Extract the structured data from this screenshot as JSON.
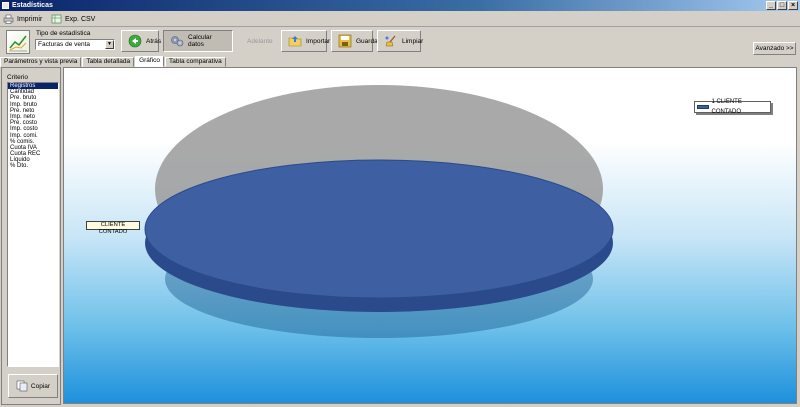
{
  "window": {
    "title": "Estadísticas",
    "buttons": [
      "_",
      "□",
      "×"
    ]
  },
  "menu": [
    {
      "label": "Imprimir",
      "icon": "printer-icon"
    },
    {
      "label": "Exp. CSV",
      "icon": "csv-export-icon"
    }
  ],
  "toolbar": {
    "type_label": "Tipo de estadística",
    "type_value": "Facturas de venta",
    "back_label": "Atrás",
    "calc_label": "Calcular datos",
    "next_label": "Adelante",
    "import_label": "Importar",
    "save_label": "Guardar",
    "clear_label": "Limpiar",
    "advanced_label": "Avanzado >>"
  },
  "tabs": [
    "Parámetros y vista previa",
    "Tabla detallada",
    "Gráfico",
    "Tabla comparativa"
  ],
  "active_tab": "Gráfico",
  "criterio": {
    "label": "Criterio",
    "items": [
      "Registros",
      "Cantidad",
      "Pre. bruto",
      "Imp. bruto",
      "Pre. neto",
      "Imp. neto",
      "Pre. costo",
      "Imp. costo",
      "Imp. comi.",
      "% comis.",
      "Cuota IVA",
      "Cuota REC",
      "Líquido",
      "% Dto."
    ],
    "selected": "Registros",
    "copy_label": "Copiar"
  },
  "chart_data": {
    "type": "pie",
    "categories": [
      "CLIENTE CONTADO"
    ],
    "values": [
      1
    ],
    "legend": {
      "entries": [
        "1 CLIENTE CONTADO"
      ],
      "placement": "top-right"
    },
    "slice_labels": [
      "CLIENTE CONTADO"
    ],
    "colors": {
      "slice": "#3f5fa3",
      "slice_edge": "#2a4a8c",
      "shadow": "#9a9a9a"
    }
  }
}
